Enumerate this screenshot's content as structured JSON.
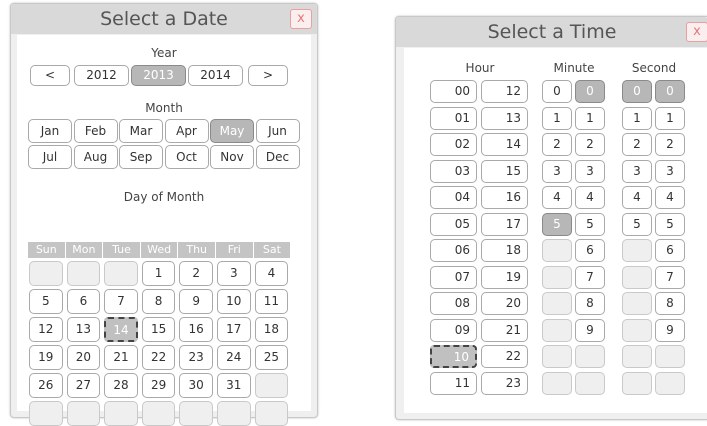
{
  "date_picker": {
    "title": "Select a Date",
    "close_glyph": "x",
    "year": {
      "label": "Year",
      "prev": "<",
      "next": ">",
      "options": [
        "2012",
        "2013",
        "2014"
      ],
      "selected": "2013"
    },
    "month": {
      "label": "Month",
      "options": [
        "Jan",
        "Feb",
        "Mar",
        "Apr",
        "May",
        "Jun",
        "Jul",
        "Aug",
        "Sep",
        "Oct",
        "Nov",
        "Dec"
      ],
      "selected": "May"
    },
    "day": {
      "label": "Day of Month",
      "weekdays": [
        "Sun",
        "Mon",
        "Tue",
        "Wed",
        "Thu",
        "Fri",
        "Sat"
      ],
      "cells": [
        "",
        "",
        "",
        "1",
        "2",
        "3",
        "4",
        "5",
        "6",
        "7",
        "8",
        "9",
        "10",
        "11",
        "12",
        "13",
        "14",
        "15",
        "16",
        "17",
        "18",
        "19",
        "20",
        "21",
        "22",
        "23",
        "24",
        "25",
        "26",
        "27",
        "28",
        "29",
        "30",
        "31",
        "",
        "",
        "",
        "",
        "",
        "",
        "",
        ""
      ],
      "today": "14"
    }
  },
  "time_picker": {
    "title": "Select a Time",
    "close_glyph": "x",
    "hour": {
      "label": "Hour",
      "col1": [
        "00",
        "01",
        "02",
        "03",
        "04",
        "05",
        "06",
        "07",
        "08",
        "09",
        "10",
        "11"
      ],
      "col2": [
        "12",
        "13",
        "14",
        "15",
        "16",
        "17",
        "18",
        "19",
        "20",
        "21",
        "22",
        "23"
      ],
      "current": "10"
    },
    "minute": {
      "label": "Minute",
      "tens": [
        "0",
        "1",
        "2",
        "3",
        "4",
        "5",
        "",
        "",
        "",
        "",
        "",
        ""
      ],
      "ones": [
        "0",
        "1",
        "2",
        "3",
        "4",
        "5",
        "6",
        "7",
        "8",
        "9",
        "",
        ""
      ],
      "selected_tens": "5",
      "selected_ones": "0"
    },
    "second": {
      "label": "Second",
      "tens": [
        "0",
        "1",
        "2",
        "3",
        "4",
        "5",
        "",
        "",
        "",
        "",
        "",
        ""
      ],
      "ones": [
        "0",
        "1",
        "2",
        "3",
        "4",
        "5",
        "6",
        "7",
        "8",
        "9",
        "",
        ""
      ],
      "selected_tens": "0",
      "selected_ones": "0"
    }
  },
  "colors": {
    "panel_bg": "#efefef",
    "titlebar_bg": "#d9d9d9",
    "selected_bg": "#b7b7b7",
    "close_red": "#e87878"
  }
}
